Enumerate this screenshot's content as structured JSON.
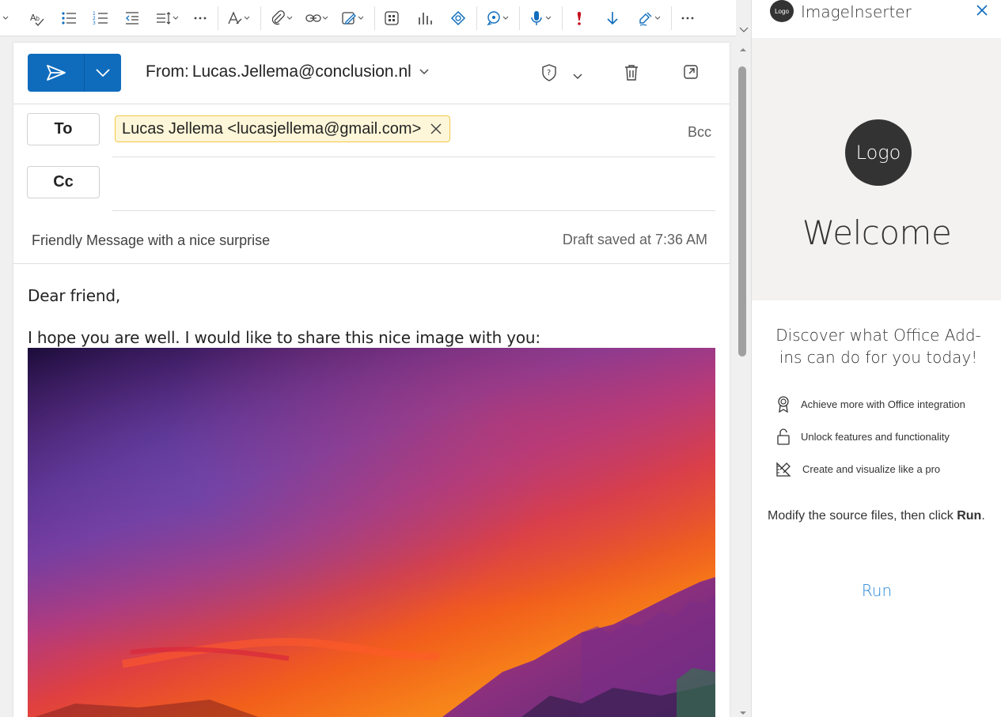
{
  "toolbar": {
    "buttons": [
      {
        "name": "spelling-icon"
      },
      {
        "name": "bullet-list-icon"
      },
      {
        "name": "numbered-list-icon"
      },
      {
        "name": "decrease-indent-icon"
      },
      {
        "name": "line-spacing-icon"
      },
      {
        "name": "more-formatting-icon"
      },
      {
        "name": "editor-icon"
      },
      {
        "name": "attach-icon"
      },
      {
        "name": "link-icon"
      },
      {
        "name": "signature-icon"
      },
      {
        "name": "apps-icon"
      },
      {
        "name": "insights-icon"
      },
      {
        "name": "loop-icon"
      },
      {
        "name": "copilot-icon"
      },
      {
        "name": "dictate-icon"
      },
      {
        "name": "high-importance-icon"
      },
      {
        "name": "low-importance-icon"
      },
      {
        "name": "sensitivity-icon"
      },
      {
        "name": "more-options-icon"
      }
    ]
  },
  "compose": {
    "from_label": "From:",
    "from_address": "Lucas.Jellema@conclusion.nl",
    "to_button": "To",
    "cc_button": "Cc",
    "bcc_link": "Bcc",
    "to_recipient": "Lucas Jellema <lucasjellema@gmail.com>",
    "subject": "Friendly Message with a nice surprise",
    "draft_status": "Draft saved at 7:36 AM",
    "body_greeting": "Dear friend,",
    "body_text": "I hope you are well. I would like to share this nice image with you:"
  },
  "addin": {
    "logo_small": "Logo",
    "title": "ImageInserter",
    "hero_logo": "Logo",
    "welcome": "Welcome",
    "discover": "Discover what Office Add-ins can do for you today!",
    "features": [
      {
        "icon": "ribbon-icon",
        "label": "Achieve more with Office integration"
      },
      {
        "icon": "unlock-icon",
        "label": "Unlock features and functionality"
      },
      {
        "icon": "design-icon",
        "label": "Create and visualize like a pro"
      }
    ],
    "modify_prefix": "Modify the source files, then click ",
    "modify_bold": "Run",
    "modify_suffix": ".",
    "run_button": "Run"
  },
  "colors": {
    "accent": "#0f6cbd",
    "chip_bg": "#fdf6d8",
    "chip_border": "#f2c94c",
    "run_link": "#2b88d8",
    "importance": "#c50f1f"
  }
}
